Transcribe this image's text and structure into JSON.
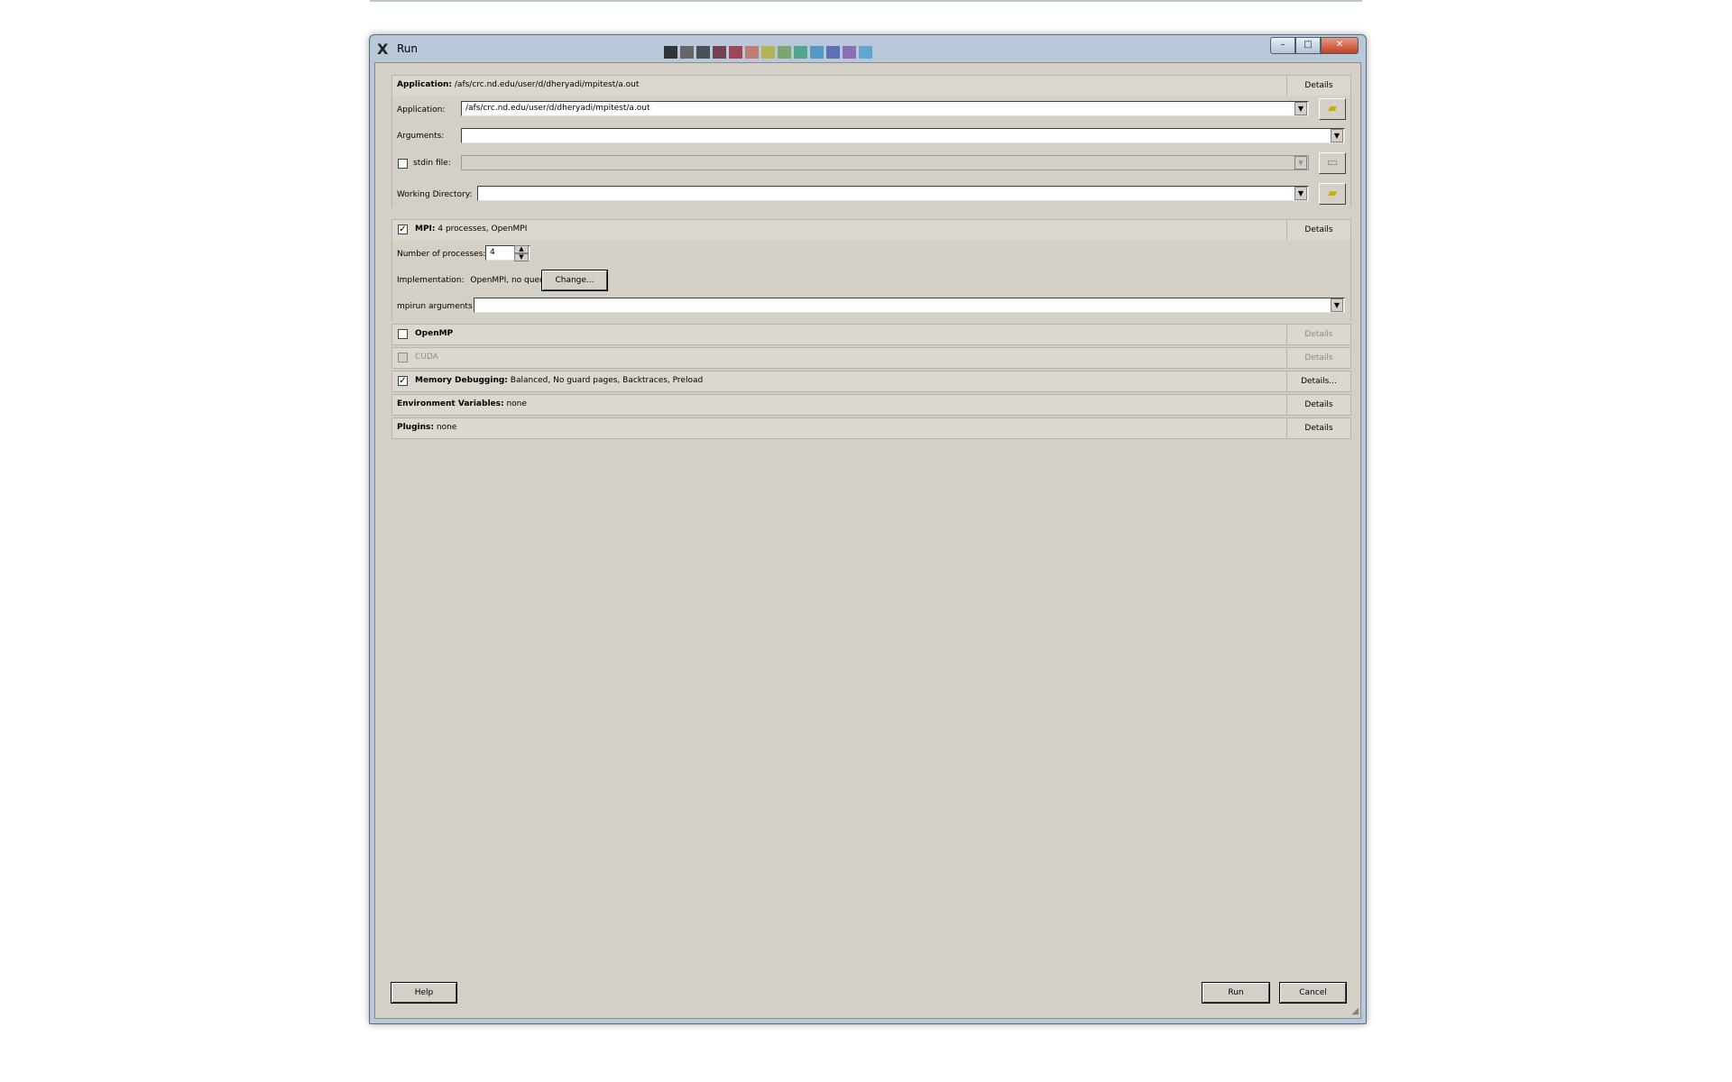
{
  "window": {
    "title": "Run",
    "title_colors": [
      "#1a1a1a",
      "#555555",
      "#3a3a40",
      "#6a2a3a",
      "#9a3040",
      "#c07060",
      "#b0b040",
      "#70a060",
      "#40a080",
      "#4090c0",
      "#5060b0",
      "#8060b0",
      "#50a0d0"
    ]
  },
  "application": {
    "section_label": "Application:",
    "section_value": "/afs/crc.nd.edu/user/d/dheryadi/mpitest/a.out",
    "details_label": "Details",
    "app_label": "Application:",
    "app_value": "/afs/crc.nd.edu/user/d/dheryadi/mpitest/a.out",
    "arguments_label": "Arguments:",
    "arguments_value": "",
    "stdin_label": "stdin file:",
    "stdin_value": "",
    "workdir_label": "Working Directory:",
    "workdir_value": ""
  },
  "mpi": {
    "section_label": "MPI:",
    "section_value": "4 processes, OpenMPI",
    "checked": true,
    "details_label": "Details",
    "nproc_label": "Number of processes:",
    "nproc_value": "4",
    "impl_label": "Implementation:",
    "impl_value": "OpenMPI, no queue",
    "change_label": "Change...",
    "mpirun_label": "mpirun arguments",
    "mpirun_value": ""
  },
  "openmp": {
    "label": "OpenMP",
    "checked": false,
    "details_label": "Details"
  },
  "cuda": {
    "label": "CUDA",
    "checked": false,
    "details_label": "Details"
  },
  "memdebug": {
    "label": "Memory Debugging:",
    "value": "Balanced, No guard pages, Backtraces, Preload",
    "checked": true,
    "details_label": "Details..."
  },
  "envvars": {
    "label": "Environment Variables:",
    "value": "none",
    "details_label": "Details"
  },
  "plugins": {
    "label": "Plugins:",
    "value": "none",
    "details_label": "Details"
  },
  "footer": {
    "help_label": "Help",
    "run_label": "Run",
    "cancel_label": "Cancel"
  },
  "icons": {
    "check": "✓",
    "dropdown": "▼",
    "folder": "folder-icon",
    "x_logo": "X"
  }
}
